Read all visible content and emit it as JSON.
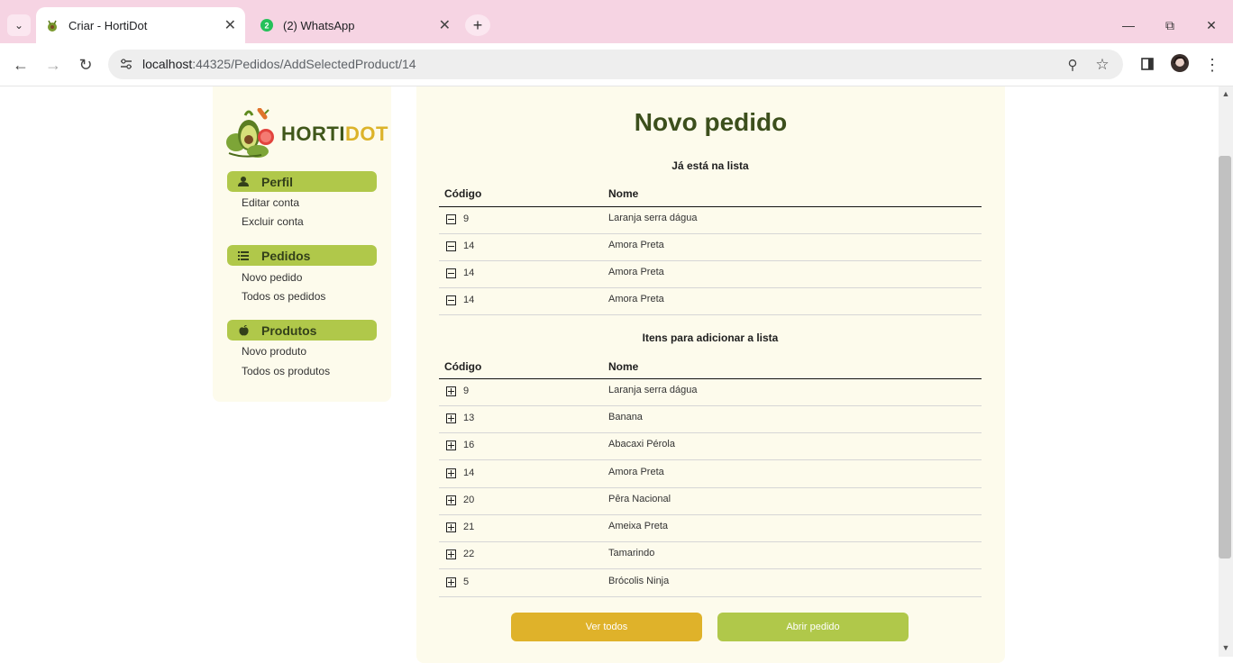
{
  "browser": {
    "tabs": [
      {
        "title": "Criar - HortiDot",
        "active": true,
        "icon": "hortidot-favicon"
      },
      {
        "title": "(2) WhatsApp",
        "active": false,
        "icon": "whatsapp-favicon",
        "badge": "2"
      }
    ],
    "url_host": "localhost",
    "url_path": ":44325/Pedidos/AddSelectedProduct/14"
  },
  "logo": {
    "brand_part1": "HORTI",
    "brand_part2": "DOT"
  },
  "sidebar": {
    "sections": [
      {
        "label": "Perfil",
        "icon": "user-icon",
        "links": [
          "Editar conta",
          "Excluir conta"
        ]
      },
      {
        "label": "Pedidos",
        "icon": "list-icon",
        "links": [
          "Novo pedido",
          "Todos os pedidos"
        ]
      },
      {
        "label": "Produtos",
        "icon": "apple-icon",
        "links": [
          "Novo produto",
          "Todos os produtos"
        ]
      }
    ]
  },
  "main": {
    "title": "Novo pedido",
    "in_list": {
      "caption": "Já está na lista",
      "headers": {
        "code": "Código",
        "name": "Nome"
      },
      "rows": [
        {
          "code": "9",
          "name": "Laranja serra dágua"
        },
        {
          "code": "14",
          "name": "Amora Preta"
        },
        {
          "code": "14",
          "name": "Amora Preta"
        },
        {
          "code": "14",
          "name": "Amora Preta"
        }
      ]
    },
    "to_add": {
      "caption": "Itens para adicionar a lista",
      "headers": {
        "code": "Código",
        "name": "Nome"
      },
      "rows": [
        {
          "code": "9",
          "name": "Laranja serra dágua"
        },
        {
          "code": "13",
          "name": "Banana"
        },
        {
          "code": "16",
          "name": "Abacaxi Pérola"
        },
        {
          "code": "14",
          "name": "Amora Preta"
        },
        {
          "code": "20",
          "name": "Pêra Nacional"
        },
        {
          "code": "21",
          "name": "Ameixa Preta"
        },
        {
          "code": "22",
          "name": "Tamarindo"
        },
        {
          "code": "5",
          "name": "Brócolis Ninja"
        }
      ]
    },
    "buttons": {
      "see_all": "Ver todos",
      "open_order": "Abrir pedido"
    }
  },
  "colors": {
    "accent_green": "#b0c84a",
    "accent_yellow": "#dfb22a",
    "panel_bg": "#fdfbec",
    "title_green": "#3c4f1c",
    "chrome_pink": "#f6d4e3"
  }
}
